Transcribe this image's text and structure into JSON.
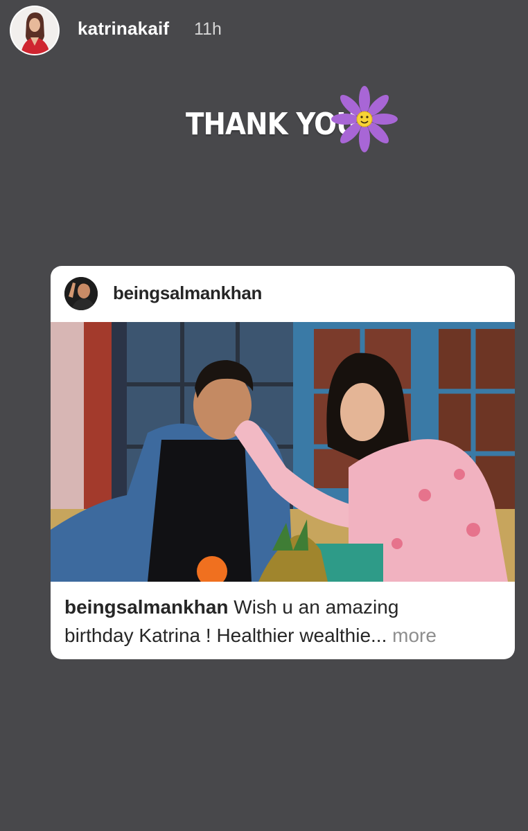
{
  "story": {
    "username": "katrinakaif",
    "time": "11h"
  },
  "sticker": {
    "text": "THANK YOU",
    "icon": "smiley-flower-icon",
    "flower_color": "#a866d6"
  },
  "shared_post": {
    "username": "beingsalmankhan",
    "caption_user": "beingsalmankhan",
    "caption_line1": " Wish u an amazing",
    "caption_line2": "birthday Katrina ! Healthier wealthie...",
    "more_label": " more"
  },
  "colors": {
    "background": "#48484b",
    "card": "#ffffff",
    "text": "#262626",
    "muted": "#8e8e8e"
  }
}
